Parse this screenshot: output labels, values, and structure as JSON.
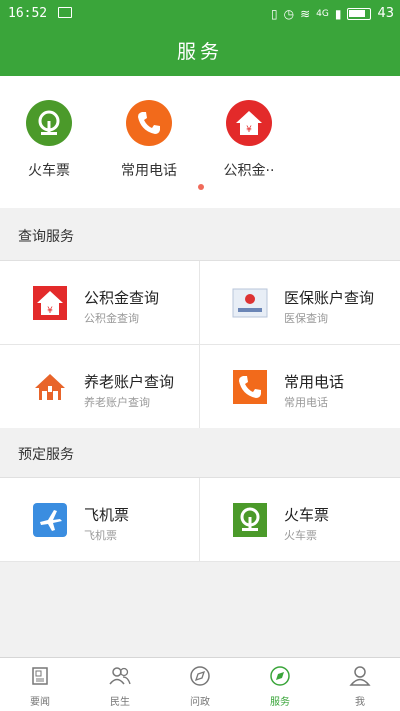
{
  "status": {
    "time": "16:52",
    "battery": "43",
    "network": "4G"
  },
  "title": "服务",
  "quick": [
    {
      "label": "火车票",
      "icon": "train-icon",
      "color": "#4b9a2a"
    },
    {
      "label": "常用电话",
      "icon": "phone-icon",
      "color": "#f26a1b"
    },
    {
      "label": "公积金··",
      "icon": "housing-fund-icon",
      "color": "#e32a2a"
    }
  ],
  "sections": {
    "query": "查询服务",
    "booking": "预定服务"
  },
  "query_items": [
    {
      "title": "公积金查询",
      "sub": "公积金查询",
      "icon": "housing-fund-icon"
    },
    {
      "title": "医保账户查询",
      "sub": "医保查询",
      "icon": "medical-insurance-card-icon"
    },
    {
      "title": "养老账户查询",
      "sub": "养老账户查询",
      "icon": "pension-house-icon"
    },
    {
      "title": "常用电话",
      "sub": "常用电话",
      "icon": "phone-icon"
    }
  ],
  "booking_items": [
    {
      "title": "飞机票",
      "sub": "飞机票",
      "icon": "airplane-icon"
    },
    {
      "title": "火车票",
      "sub": "火车票",
      "icon": "train-icon"
    }
  ],
  "tabs": [
    {
      "label": "要闻",
      "icon": "news-icon"
    },
    {
      "label": "民生",
      "icon": "people-icon"
    },
    {
      "label": "问政",
      "icon": "compass-icon"
    },
    {
      "label": "服务",
      "icon": "service-compass-icon",
      "active": true
    },
    {
      "label": "我",
      "icon": "user-icon"
    }
  ],
  "colors": {
    "primary": "#3aa53a",
    "accent_red": "#e32a2a",
    "accent_orange": "#f26a1b"
  }
}
